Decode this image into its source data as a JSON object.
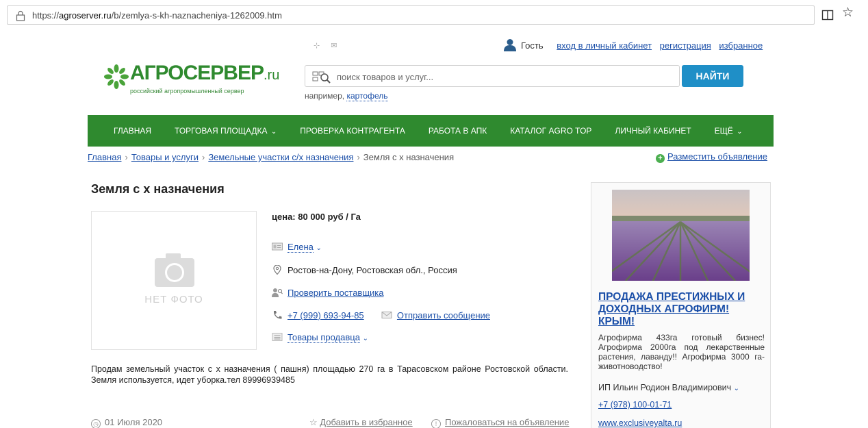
{
  "browser": {
    "url_prefix": "https://",
    "url_host": "agroserver.ru",
    "url_path": "/b/zemlya-s-kh-naznacheniya-1262009.htm"
  },
  "userbar": {
    "guest": "Гость",
    "login": "вход в личный кабинет",
    "register": "регистрация",
    "favorites": "избранное"
  },
  "logo": {
    "name": "АГРОСЕРВЕР",
    "tld": ".ru",
    "tagline": "российский агропромышленный сервер"
  },
  "search": {
    "placeholder": "поиск товаров и услуг...",
    "button": "НАЙТИ",
    "example_prefix": "например, ",
    "example_link": "картофель"
  },
  "nav": {
    "items": [
      {
        "label": "ГЛАВНАЯ",
        "chev": ""
      },
      {
        "label": "ТОРГОВАЯ ПЛОЩАДКА",
        "chev": "⌄"
      },
      {
        "label": "ПРОВЕРКА КОНТРАГЕНТА",
        "chev": ""
      },
      {
        "label": "РАБОТА В АПК",
        "chev": ""
      },
      {
        "label": "КАТАЛОГ AGRO TOP",
        "chev": ""
      },
      {
        "label": "ЛИЧНЫЙ КАБИНЕТ",
        "chev": ""
      },
      {
        "label": "ЕЩЁ",
        "chev": "⌄"
      }
    ]
  },
  "breadcrumb": {
    "items": [
      "Главная",
      "Товары и услуги",
      "Земельные участки с/х назначения"
    ],
    "current": "Земля с х назначения",
    "post_ad": "Разместить объявление"
  },
  "listing": {
    "title": "Земля с х назначения",
    "no_photo": "НЕТ ФОТО",
    "price": "цена: 80 000 руб / Га",
    "seller": "Елена",
    "location": "Ростов-на-Дону, Ростовская обл., Россия",
    "check_supplier": "Проверить поставщика",
    "phone": "+7 (999) 693-94-85",
    "send_message": "Отправить сообщение",
    "seller_goods": "Товары продавца",
    "description": "Продам земельный участок с х назначения ( пашня) площадью 270 га в Тарасовском районе Ростовской области. Земля используется, идет уборка.тел 89996939485",
    "date": "01 Июля 2020",
    "add_favorites": "Добавить в избранное",
    "complain": "Пожаловаться на объявление"
  },
  "ad": {
    "title": "ПРОДАЖА ПРЕСТИЖНЫХ И ДОХОДНЫХ АГРОФИРМ! КРЫМ!",
    "text": "Агрофирма 433га готовый бизнес! Агрофирма 2000га под лекарственные растения, лаванду!! Агрофирма 3000 га- животноводство!",
    "seller": "ИП Ильин Родион Владимирович",
    "phone": "+7 (978) 100-01-71",
    "site": "www.exclusiveyalta.ru"
  }
}
